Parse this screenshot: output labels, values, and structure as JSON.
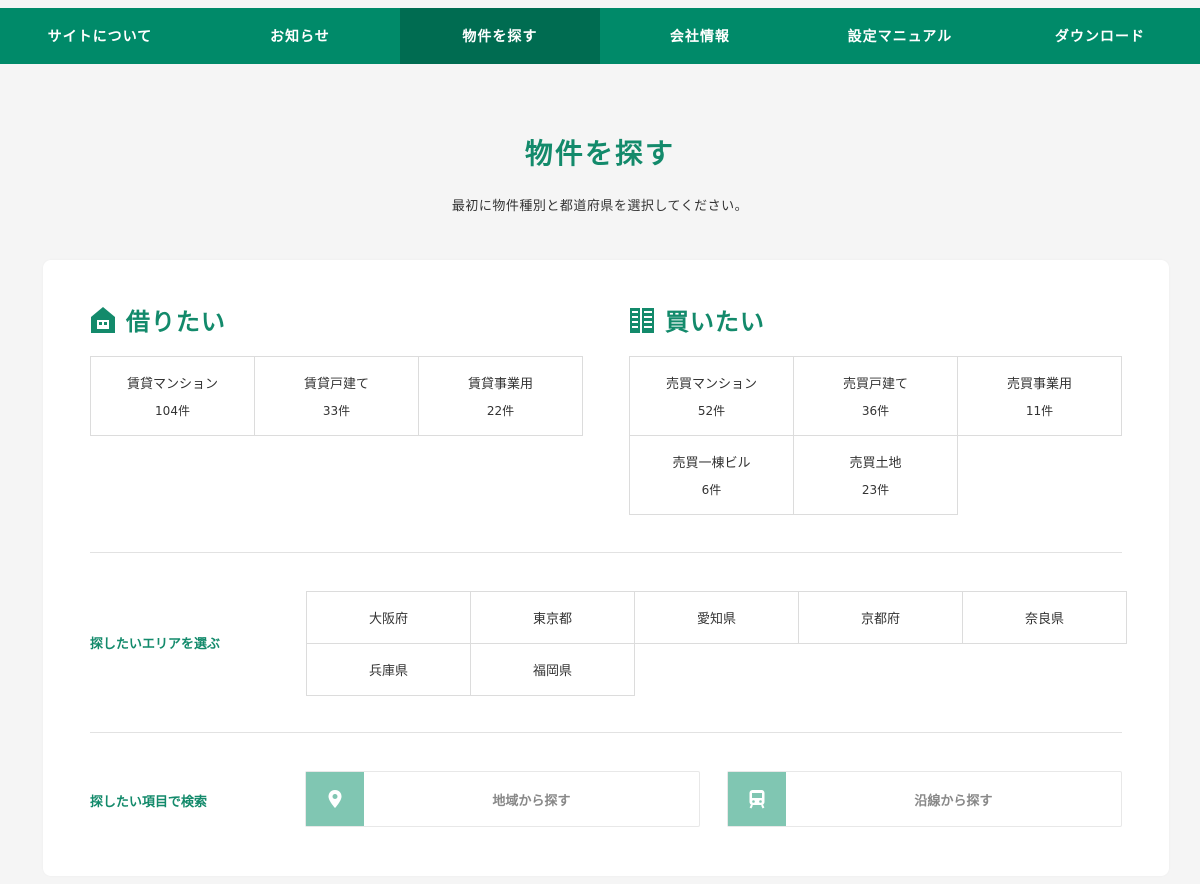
{
  "nav": {
    "items": [
      {
        "label": "サイトについて"
      },
      {
        "label": "お知らせ"
      },
      {
        "label": "物件を探す"
      },
      {
        "label": "会社情報"
      },
      {
        "label": "設定マニュアル"
      },
      {
        "label": "ダウンロード"
      }
    ],
    "active_index": 2
  },
  "page": {
    "title": "物件を探す",
    "subtitle": "最初に物件種別と都道府県を選択してください。"
  },
  "rent": {
    "heading": "借りたい",
    "icon": "house-icon",
    "items": [
      {
        "label": "賃貸マンション",
        "count": "104件"
      },
      {
        "label": "賃貸戸建て",
        "count": "33件"
      },
      {
        "label": "賃貸事業用",
        "count": "22件"
      }
    ]
  },
  "buy": {
    "heading": "買いたい",
    "icon": "building-icon",
    "items": [
      {
        "label": "売買マンション",
        "count": "52件"
      },
      {
        "label": "売買戸建て",
        "count": "36件"
      },
      {
        "label": "売買事業用",
        "count": "11件"
      },
      {
        "label": "売買一棟ビル",
        "count": "6件"
      },
      {
        "label": "売買土地",
        "count": "23件"
      }
    ]
  },
  "area": {
    "label": "探したいエリアを選ぶ",
    "items": [
      "大阪府",
      "東京都",
      "愛知県",
      "京都府",
      "奈良県",
      "兵庫県",
      "福岡県"
    ]
  },
  "search": {
    "label": "探したい項目で検索",
    "region_button": "地域から探す",
    "line_button": "沿線から探す",
    "region_icon": "map-pin-icon",
    "line_icon": "train-icon"
  },
  "colors": {
    "primary": "#008a69",
    "primary_dark": "#006c51",
    "accent_text": "#138a6b",
    "icon_bg": "#80c6b2"
  }
}
